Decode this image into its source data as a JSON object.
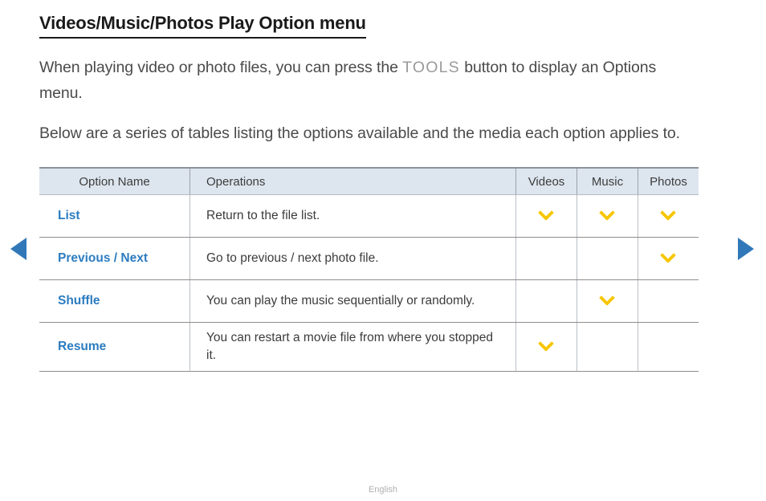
{
  "nav": {
    "prev_label": "Previous page",
    "next_label": "Next page"
  },
  "page": {
    "title": "Videos/Music/Photos Play Option menu",
    "paragraph_1_before": "When playing video or photo files, you can press the ",
    "paragraph_1_key": "TOOLS",
    "paragraph_1_after": " button to display an Options menu.",
    "paragraph_2": "Below are a series of tables listing the options available and the media each option applies to."
  },
  "table": {
    "headers": {
      "option_name": "Option Name",
      "operations": "Operations",
      "videos": "Videos",
      "music": "Music",
      "photos": "Photos"
    },
    "rows": [
      {
        "name": "List",
        "operation": "Return to the file list.",
        "videos": true,
        "music": true,
        "photos": true
      },
      {
        "name": "Previous / Next",
        "operation": "Go to previous / next photo file.",
        "videos": false,
        "music": false,
        "photos": true
      },
      {
        "name": "Shuffle",
        "operation": "You can play the music sequentially or randomly.",
        "videos": false,
        "music": true,
        "photos": false
      },
      {
        "name": "Resume",
        "operation": "You can restart a movie file from where you stopped it.",
        "videos": true,
        "music": false,
        "photos": false
      }
    ]
  },
  "footer": {
    "language": "English"
  },
  "colors": {
    "accent_blue": "#2c7cc0",
    "nav_arrow_blue": "#3178b9",
    "check_yellow": "#f7c600",
    "header_bg": "#dde6ef",
    "tools_gray": "#9a9a9a"
  }
}
